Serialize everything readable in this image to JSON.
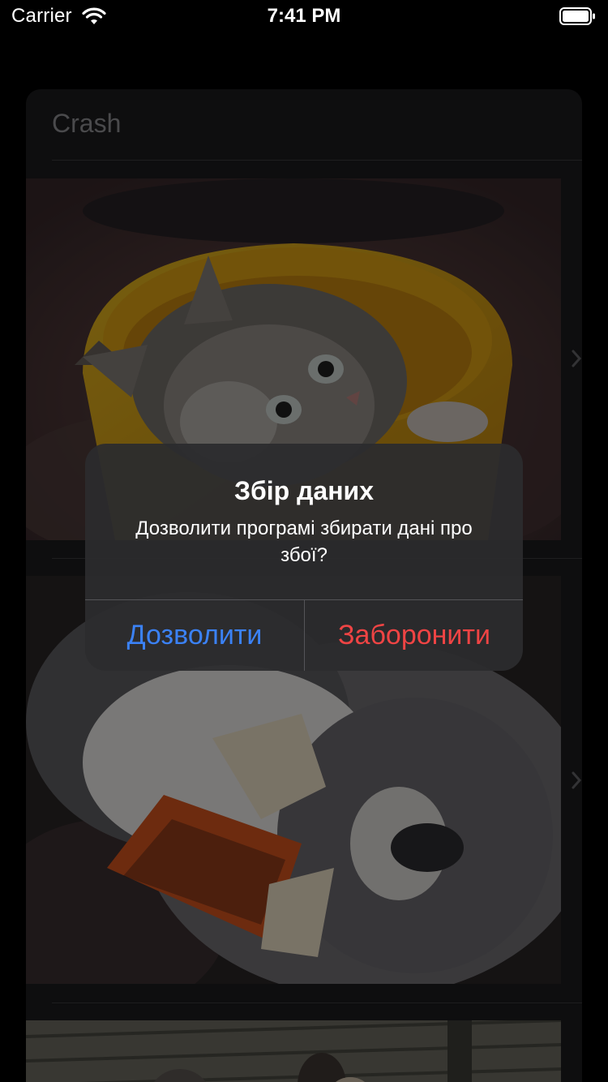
{
  "status_bar": {
    "carrier": "Carrier",
    "time": "7:41 PM",
    "wifi_icon": "wifi-icon",
    "battery_icon": "battery-icon"
  },
  "card": {
    "title": "Crash",
    "items": [
      {
        "image": "kitten-in-yellow-bowl"
      },
      {
        "image": "gray-cat-with-orange-bow-tie"
      },
      {
        "image": "cats-on-wooden-deck"
      }
    ]
  },
  "alert": {
    "title": "Збір даних",
    "message": "Дозволити програмі збирати дані про збої?",
    "allow_label": "Дозволити",
    "deny_label": "Заборонити"
  },
  "colors": {
    "background": "#000000",
    "card": "#1c1c1e",
    "alert_bg": "#2c2c2e",
    "allow": "#3b82f6",
    "deny": "#ef4444"
  }
}
